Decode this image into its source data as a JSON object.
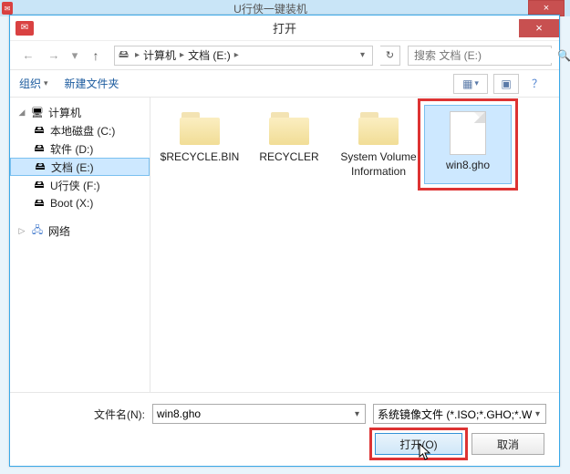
{
  "bg": {
    "title": "U行侠一键装机",
    "close": "×"
  },
  "dialog": {
    "title": "打开",
    "close": "×"
  },
  "nav": {
    "back_glyph": "←",
    "fwd_glyph": "→",
    "dd_glyph": "▾",
    "up_glyph": "↑",
    "refresh_glyph": "↻"
  },
  "address": {
    "drive_icon": "🖴",
    "seg1": "计算机",
    "seg2": "文档 (E:)",
    "sep": "▸",
    "drop": "▾"
  },
  "search": {
    "placeholder": "搜索 文档 (E:)",
    "icon": "🔍"
  },
  "toolbar": {
    "organize": "组织",
    "newfolder": "新建文件夹",
    "view_glyph": "▦",
    "view_dd": "▾",
    "preview_glyph": "▣",
    "help_glyph": "？"
  },
  "tree": {
    "computer": {
      "label": "计算机",
      "exp": "◢"
    },
    "items": [
      {
        "label": "本地磁盘 (C:)"
      },
      {
        "label": "软件 (D:)"
      },
      {
        "label": "文档 (E:)"
      },
      {
        "label": "U行侠 (F:)"
      },
      {
        "label": "Boot (X:)"
      }
    ],
    "network": {
      "label": "网络",
      "exp": "▷"
    }
  },
  "files": [
    {
      "type": "folder",
      "label": "$RECYCLE.BIN"
    },
    {
      "type": "folder",
      "label": "RECYCLER"
    },
    {
      "type": "folder",
      "label": "System Volume Information"
    },
    {
      "type": "file",
      "label": "win8.gho",
      "selected": true
    }
  ],
  "bottom": {
    "filename_label": "文件名(N):",
    "filename_value": "win8.gho",
    "filetype_value": "系统镜像文件 (*.ISO;*.GHO;*.W",
    "open": "打开(O)",
    "cancel": "取消"
  },
  "chart_data": null
}
